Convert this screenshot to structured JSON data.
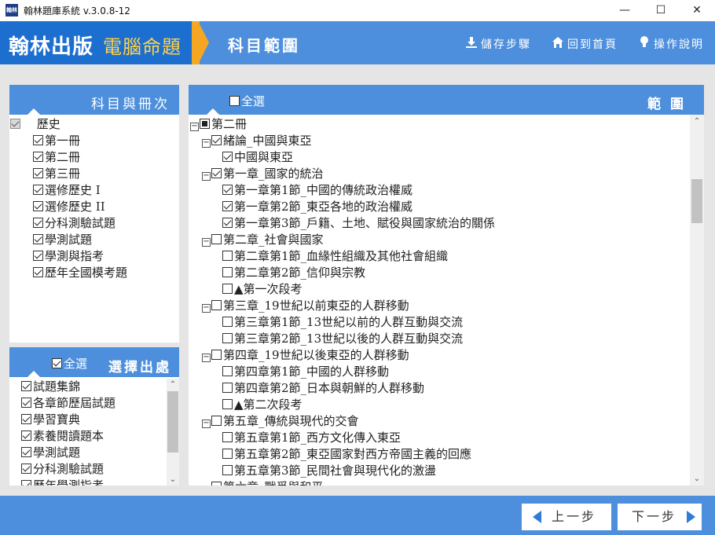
{
  "window": {
    "app_icon_text": "翰林",
    "title": "翰林題庫系統 v.3.0.8-12",
    "minimize": "—",
    "maximize": "☐",
    "close": "✕"
  },
  "header": {
    "brand_main": "翰林出版",
    "brand_sub": "電腦命題",
    "page_title": "科目範圍",
    "links": [
      {
        "label": "儲存步驟",
        "icon": "download-icon"
      },
      {
        "label": "回到首頁",
        "icon": "home-icon"
      },
      {
        "label": "操作說明",
        "icon": "lightbulb-icon"
      }
    ]
  },
  "subject_panel": {
    "title": "科目與冊次",
    "root": {
      "label": "歷史",
      "checked": true
    },
    "volumes": [
      {
        "label": "第一冊",
        "checked": true
      },
      {
        "label": "第二冊",
        "checked": true
      },
      {
        "label": "第三冊",
        "checked": true
      },
      {
        "label": "選修歷史 I",
        "checked": true
      },
      {
        "label": "選修歷史 II",
        "checked": true
      },
      {
        "label": "分科測驗試題",
        "checked": true
      },
      {
        "label": "學測試題",
        "checked": true
      },
      {
        "label": "學測與指考",
        "checked": true
      },
      {
        "label": "歷年全國模考題",
        "checked": true
      }
    ]
  },
  "source_panel": {
    "select_all": "全選",
    "title": "選擇出處",
    "items": [
      {
        "label": "試題集錦",
        "checked": true
      },
      {
        "label": "各章節歷屆試題",
        "checked": true
      },
      {
        "label": "學習寶典",
        "checked": true
      },
      {
        "label": "素養閱讀題本",
        "checked": true
      },
      {
        "label": "學測試題",
        "checked": true
      },
      {
        "label": "分科測驗試題",
        "checked": true
      },
      {
        "label": "歷年學測指考",
        "checked": true
      }
    ]
  },
  "range_panel": {
    "select_all": "全選",
    "title": "範圍",
    "tree": [
      {
        "level": 0,
        "toggle": "−",
        "state": "partial",
        "label": "第二冊"
      },
      {
        "level": 1,
        "toggle": "−",
        "state": "checked",
        "label": "緒論_中國與東亞"
      },
      {
        "level": 2,
        "toggle": "",
        "state": "checked",
        "label": "中國與東亞"
      },
      {
        "level": 1,
        "toggle": "−",
        "state": "checked",
        "label": "第一章_國家的統治"
      },
      {
        "level": 2,
        "toggle": "",
        "state": "checked",
        "label": "第一章第1節_中國的傳統政治權威"
      },
      {
        "level": 2,
        "toggle": "",
        "state": "checked",
        "label": "第一章第2節_東亞各地的政治權威"
      },
      {
        "level": 2,
        "toggle": "",
        "state": "checked",
        "label": "第一章第3節_戶籍、土地、賦役與國家統治的關係"
      },
      {
        "level": 1,
        "toggle": "−",
        "state": "unchecked",
        "label": "第二章_社會與國家"
      },
      {
        "level": 2,
        "toggle": "",
        "state": "unchecked",
        "label": "第二章第1節_血緣性組織及其他社會組織"
      },
      {
        "level": 2,
        "toggle": "",
        "state": "unchecked",
        "label": "第二章第2節_信仰與宗教"
      },
      {
        "level": 2,
        "toggle": "",
        "state": "unchecked",
        "label": "▲第一次段考"
      },
      {
        "level": 1,
        "toggle": "−",
        "state": "unchecked",
        "label": "第三章_19世紀以前東亞的人群移動"
      },
      {
        "level": 2,
        "toggle": "",
        "state": "unchecked",
        "label": "第三章第1節_13世紀以前的人群互動與交流"
      },
      {
        "level": 2,
        "toggle": "",
        "state": "unchecked",
        "label": "第三章第2節_13世紀以後的人群互動與交流"
      },
      {
        "level": 1,
        "toggle": "−",
        "state": "unchecked",
        "label": "第四章_19世紀以後東亞的人群移動"
      },
      {
        "level": 2,
        "toggle": "",
        "state": "unchecked",
        "label": "第四章第1節_中國的人群移動"
      },
      {
        "level": 2,
        "toggle": "",
        "state": "unchecked",
        "label": "第四章第2節_日本與朝鮮的人群移動"
      },
      {
        "level": 2,
        "toggle": "",
        "state": "unchecked",
        "label": "▲第二次段考"
      },
      {
        "level": 1,
        "toggle": "−",
        "state": "unchecked",
        "label": "第五章_傳統與現代的交會"
      },
      {
        "level": 2,
        "toggle": "",
        "state": "unchecked",
        "label": "第五章第1節_西方文化傳入東亞"
      },
      {
        "level": 2,
        "toggle": "",
        "state": "unchecked",
        "label": "第五章第2節_東亞國家對西方帝國主義的回應"
      },
      {
        "level": 2,
        "toggle": "",
        "state": "unchecked",
        "label": "第五章第3節_民間社會與現代化的激盪"
      },
      {
        "level": 1,
        "toggle": "−",
        "state": "unchecked",
        "label": "第六章_戰爭與和平"
      }
    ]
  },
  "footer": {
    "prev": "上一步",
    "next": "下一步"
  },
  "colors": {
    "header_blue": "#4d8fdc",
    "brand_blue": "#1d6fcf",
    "brand_accent": "#f5a623",
    "brand_sub_text": "#ffd24a",
    "content_bg": "#e5e5e5",
    "nav_arrow": "#2f7bd6"
  }
}
